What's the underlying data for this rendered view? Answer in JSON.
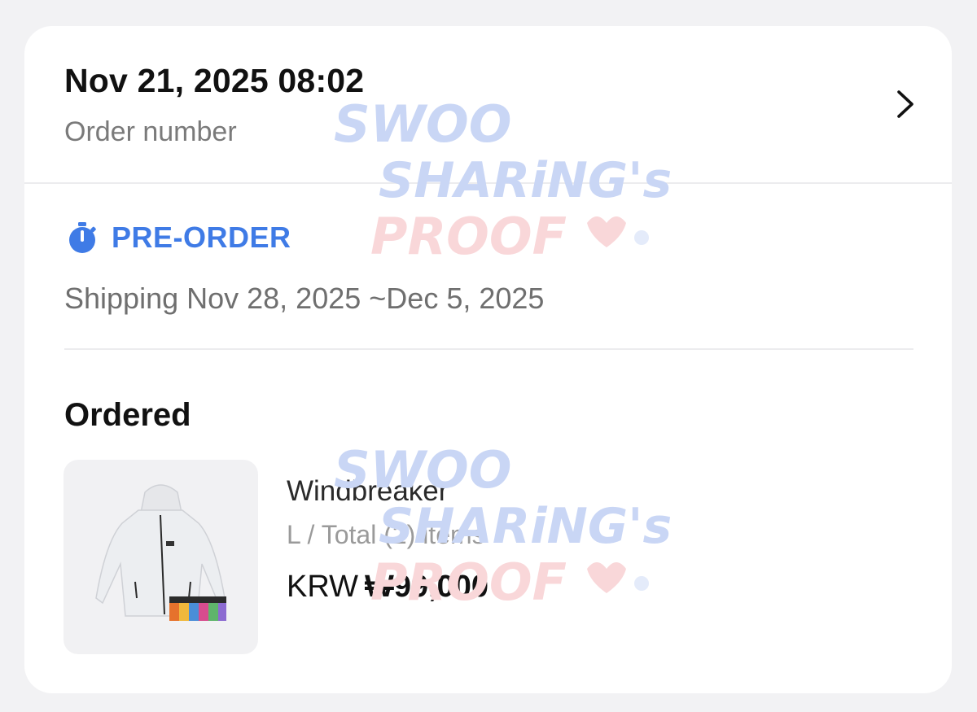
{
  "order": {
    "date": "Nov 21, 2025 08:02",
    "number_label": "Order number",
    "chevron_icon": "chevron-right-icon"
  },
  "status": {
    "icon": "stopwatch-icon",
    "label": "PRE-ORDER",
    "color": "#3f7be6",
    "shipping": "Shipping Nov 28, 2025 ~Dec 5, 2025"
  },
  "ordered": {
    "title": "Ordered",
    "item": {
      "name": "Windbreaker",
      "option": "L / Total (2) items",
      "currency": "KRW",
      "price": "₩99,000"
    }
  },
  "watermark": {
    "lines": [
      "SWOO",
      "SHARiNG's",
      "PROOF"
    ],
    "colors": [
      "#c9d6f5",
      "#f9d7d9"
    ]
  }
}
